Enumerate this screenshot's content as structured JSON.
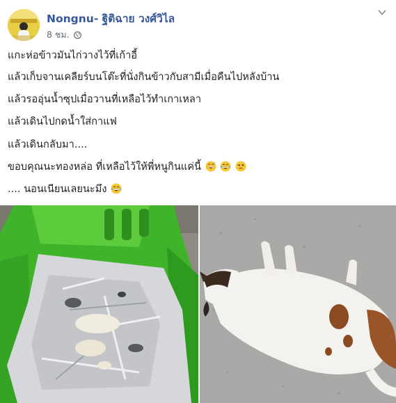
{
  "post": {
    "author": "Nongnu- ฐิติฉาย วงศ์วิไล",
    "time": "8 ชม.",
    "lines": [
      {
        "text": "แกะห่อข้าวมันไก่วางไว้ที่เก้าอี้"
      },
      {
        "text": "แล้วเก็บจานเคลียร์บนโต๊ะที่นั่งกินข้าวกับสามีเมื่อคืนไปหลังบ้าน"
      },
      {
        "text": "แล้วรออุ่นน้ำซุปเมื่อวานที่เหลือไว้ทำเกาเหลา"
      },
      {
        "text": "แล้วเดินไปกดน้ำใส่กาแฟ"
      },
      {
        "text": "แล้วเดินกลับมา...."
      },
      {
        "text": "ขอบคุณนะทองหล่อ ที่เหลือไว้ให้พี่หนูกินแค่นี้"
      },
      {
        "text": ".... นอนเนียนเลยนะมึง"
      }
    ],
    "line6_emojis": [
      "grinning-sweat-emoji",
      "tears-of-joy-emoji",
      "unamused-emoji"
    ],
    "line7_emojis": [
      "tears-of-joy-emoji"
    ]
  },
  "icons": {
    "globe": "globe-icon",
    "chevron": "chevron-down-icon"
  },
  "colors": {
    "author_link": "#365899",
    "meta_gray": "#606770",
    "chair_green": "#4cbf2a",
    "cat_brown": "#8a4a22"
  },
  "photos": {
    "left": "plastic-chair-with-empty-foil-wrapper",
    "right": "calico-cat-lying-on-concrete"
  }
}
